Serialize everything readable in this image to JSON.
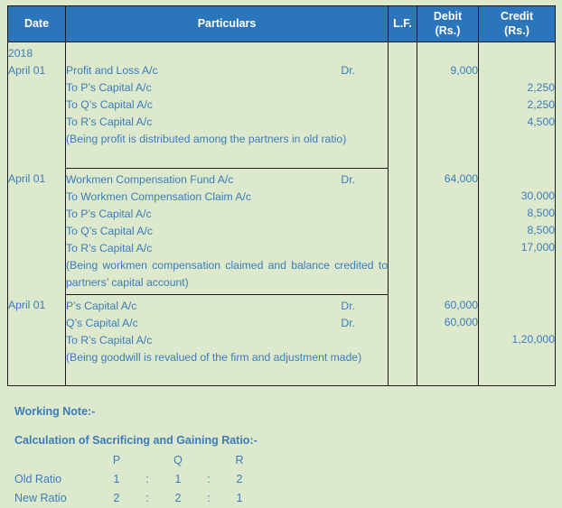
{
  "table": {
    "headers": {
      "date": "Date",
      "particulars": "Particulars",
      "lf": "L.F.",
      "debit_line1": "Debit",
      "debit_line2": "(Rs.)",
      "credit_line1": "Credit",
      "credit_line2": "(Rs.)"
    },
    "year": "2018",
    "entries": [
      {
        "date": "April 01",
        "lines": [
          {
            "text": "Profit and Loss A/c",
            "dr": "Dr.",
            "indent": 0,
            "debit": "9,000",
            "credit": ""
          },
          {
            "text": "To P’s Capital A/c",
            "dr": "",
            "indent": 1,
            "debit": "",
            "credit": "2,250"
          },
          {
            "text": "To Q’s Capital A/c",
            "dr": "",
            "indent": 1,
            "debit": "",
            "credit": "2,250"
          },
          {
            "text": "To R’s Capital A/c",
            "dr": "",
            "indent": 1,
            "debit": "",
            "credit": "4,500"
          }
        ],
        "narration": "(Being profit is distributed among the partners in old ratio)",
        "narration_lines": 2
      },
      {
        "date": "April 01",
        "lines": [
          {
            "text": "Workmen Compensation Fund A/c",
            "dr": "Dr.",
            "indent": 0,
            "debit": "64,000",
            "credit": ""
          },
          {
            "text": "To Workmen Compensation Claim A/c",
            "dr": "",
            "indent": 1,
            "debit": "",
            "credit": "30,000"
          },
          {
            "text": "To P’s Capital A/c",
            "dr": "",
            "indent": 1,
            "debit": "",
            "credit": "8,500"
          },
          {
            "text": "To Q’s Capital A/c",
            "dr": "",
            "indent": 1,
            "debit": "",
            "credit": "8,500"
          },
          {
            "text": "To R’s Capital A/c",
            "dr": "",
            "indent": 1,
            "debit": "",
            "credit": "17,000"
          }
        ],
        "narration": "(Being workmen compensation claimed and balance credited to partners’ capital account)",
        "narration_lines": 2
      },
      {
        "date": "April 01",
        "lines": [
          {
            "text": "P’s Capital A/c",
            "dr": "Dr.",
            "indent": 0,
            "debit": "60,000",
            "credit": ""
          },
          {
            "text": "Q’s Capital A/c",
            "dr": "Dr.",
            "indent": 0,
            "debit": "60,000",
            "credit": ""
          },
          {
            "text": "To R’s Capital A/c",
            "dr": "",
            "indent": 2,
            "debit": "",
            "credit": "1,20,000"
          }
        ],
        "narration": "(Being goodwill is revalued of the firm and adjustment made)",
        "narration_lines": 2
      }
    ]
  },
  "working_note": {
    "title": "Working Note:-",
    "subtitle": "Calculation of Sacrificing and Gaining Ratio:-",
    "partner_headers": [
      "P",
      "Q",
      "R"
    ],
    "rows": [
      {
        "label": "Old Ratio",
        "values": [
          "1",
          "1",
          "2"
        ],
        "sep": ":"
      },
      {
        "label": "New Ratio",
        "values": [
          "2",
          "2",
          "1"
        ],
        "sep": ":"
      }
    ]
  },
  "colors": {
    "background": "#dde9cd",
    "header_blue": "#2b76bb",
    "text_blue": "#3b7cb8",
    "border": "#1b1b1b"
  }
}
